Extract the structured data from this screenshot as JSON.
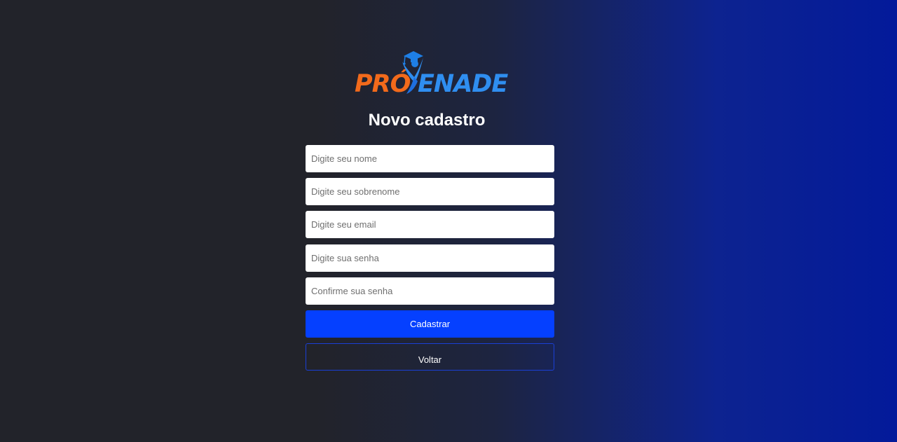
{
  "logo": {
    "part1": "PRÓ",
    "part2": "ENADE",
    "icon": "graduate-figure-icon"
  },
  "title": "Novo cadastro",
  "form": {
    "name_placeholder": "Digite seu nome",
    "surname_placeholder": "Digite seu sobrenome",
    "email_placeholder": "Digite seu email",
    "password_placeholder": "Digite sua senha",
    "confirm_placeholder": "Confirme sua senha"
  },
  "buttons": {
    "submit_label": "Cadastrar",
    "back_label": "Voltar"
  },
  "colors": {
    "primary_button": "#0540ff",
    "logo_orange": "#f26a1b",
    "logo_blue": "#2f8ef0"
  }
}
